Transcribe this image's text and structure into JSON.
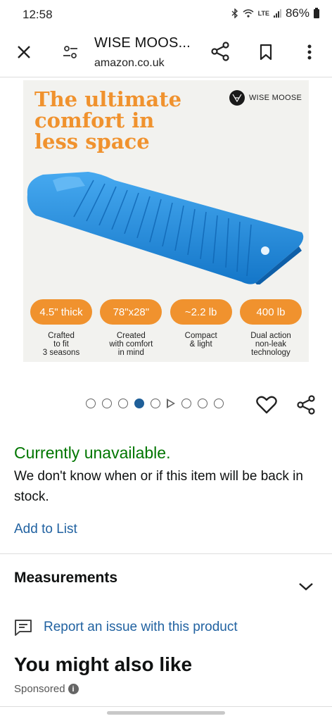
{
  "status_bar": {
    "time": "12:58",
    "network": "LTE",
    "battery": "86%"
  },
  "header": {
    "title": "WISE MOOS...",
    "domain": "amazon.co.uk"
  },
  "product_image": {
    "headline": "The ultimate comfort in less space",
    "brand": "WISE MOOSE",
    "mat_color": "#1e90e0",
    "accent_color": "#f0922e",
    "badges": [
      {
        "value": "4.5\" thick",
        "caption": "Crafted\nto fit\n3 seasons"
      },
      {
        "value": "78\"x28\"",
        "caption": "Created\nwith comfort\nin mind"
      },
      {
        "value": "~2.2 lb",
        "caption": "Compact\n& light"
      },
      {
        "value": "400 lb",
        "caption": "Dual action\nnon-leak\ntechnology"
      }
    ]
  },
  "carousel": {
    "active_index": 3,
    "dot_count_before_play": 5,
    "dot_count_after_play": 3
  },
  "availability": {
    "status": "Currently unavailable.",
    "message": "We don't know when or if this item will be back in stock.",
    "status_color": "#007600"
  },
  "actions": {
    "add_to_list": "Add to List",
    "link_color": "#2162a1"
  },
  "sections": {
    "measurements": "Measurements",
    "report": "Report an issue with this product",
    "also_like": "You might also like",
    "sponsored": "Sponsored"
  }
}
